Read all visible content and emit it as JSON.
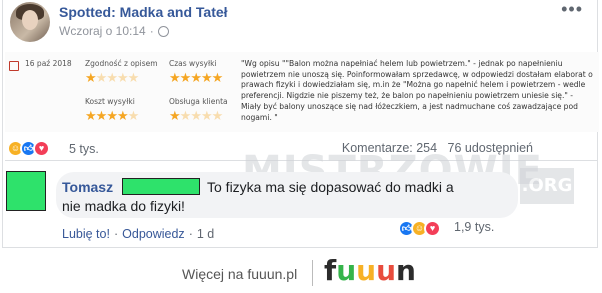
{
  "post": {
    "page_name": "Spotted: Madka and Tateł",
    "timestamp": "Wczoraj o 10:14",
    "separator": "·",
    "more_icon": "more-dots-icon",
    "privacy_icon": "globe-icon"
  },
  "review": {
    "date": "16 paź 2018",
    "criteria": [
      {
        "label": "Zgodność z opisem",
        "stars": 1
      },
      {
        "label": "Czas wysyłki",
        "stars": 5
      },
      {
        "label": "Koszt wysyłki",
        "stars": 4
      },
      {
        "label": "Obsługa klienta",
        "stars": 1
      }
    ],
    "max_stars": 5,
    "text": "\"Wg opisu \"\"Balon można napełniać helem lub powietrzem.\" - jednak po napełnieniu powietrzem nie unoszą się. Poinformowałam sprzedawcę, w odpowiedzi dostałam elaborat o prawach fizyki i dowiedziałam się, m.in że \"Można go napełnić helem i powietrzem - wedle preferencji. Nigdzie nie piszemy też, że balon po napełnieniu powietrzem uniesie się.\" - Miały być balony unoszące się nad łóżeczkiem, a jest nadmuchane coś zawadzające pod nogami. \""
  },
  "reactions": {
    "count": "5 tys.",
    "comments": "Komentarze: 254",
    "shares": "76 udostępnień"
  },
  "watermark": {
    "text": "MISTRZOWIE",
    "suffix": ".ORG"
  },
  "comment": {
    "author": "Tomasz",
    "line1": "To fizyka ma się dopasować do madki a",
    "line2": "nie madka do fizyki!",
    "like": "Lubię to!",
    "dot": "·",
    "reply": "Odpowiedz",
    "time": "1 d",
    "reaction_count": "1,9 tys."
  },
  "footer": {
    "text": "Więcej na fuuun.pl",
    "logo": "fuuun"
  },
  "colors": {
    "fb_blue": "#365899",
    "like_blue": "#1877f2",
    "love_red": "#f33e58",
    "haha_yellow": "#f7b125",
    "star": "#f5a623",
    "redaction_green": "#2ee26b"
  }
}
